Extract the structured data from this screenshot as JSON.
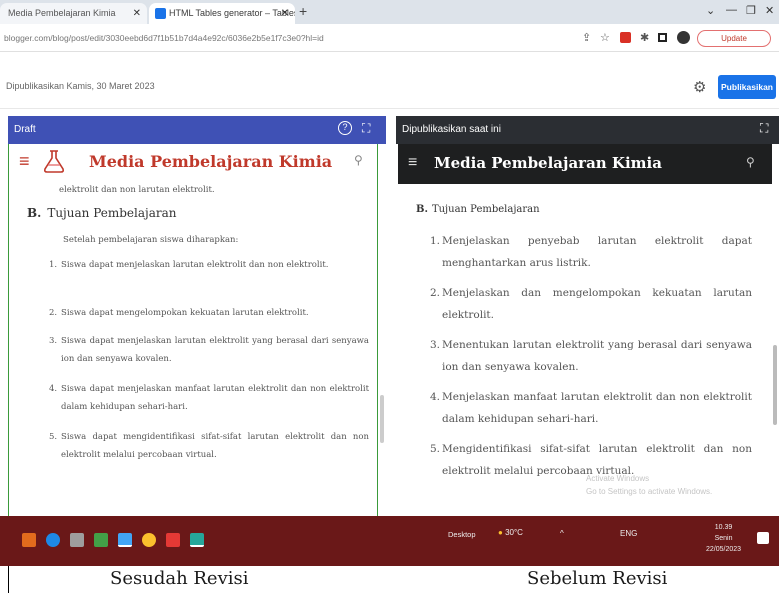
{
  "browser": {
    "tabs": [
      {
        "label": "Media Pembelajaran Kimia"
      },
      {
        "label": "HTML Tables generator – Tables"
      }
    ],
    "address": "blogger.com/blog/post/edit/3030eebd6d7f1b51b7d4a4e92c/6036e2b5e1f7c3e0?hl=id",
    "update_label": "Update"
  },
  "page": {
    "published_date": "Dipublikasikan Kamis, 30 Maret 2023",
    "publish_button": "Publikasikan"
  },
  "left": {
    "panel_label": "Draft",
    "site_title": "Media Pembelajaran Kimia",
    "cut_text": "elektrolit dan non larutan elektrolit.",
    "section_letter": "B.",
    "section_title": "Tujuan Pembelajaran",
    "intro": "Setelah pembelajaran siswa diharapkan:",
    "items": [
      {
        "n": "1.",
        "t": "Siswa dapat menjelaskan larutan elektrolit dan non elektrolit."
      },
      {
        "n": "2.",
        "t": "Siswa dapat mengelompokan kekuatan larutan elektrolit."
      },
      {
        "n": "3.",
        "t": "Siswa dapat menjelaskan larutan elektrolit yang berasal dari senyawa ion dan senyawa kovalen."
      },
      {
        "n": "4.",
        "t": "Siswa dapat menjelaskan manfaat larutan elektrolit dan non elektrolit dalam kehidupan sehari-hari."
      },
      {
        "n": "5.",
        "t": "Siswa dapat mengidentifikasi sifat-sifat larutan elektrolit dan non elektrolit melalui percobaan virtual."
      }
    ]
  },
  "right": {
    "panel_label": "Dipublikasikan saat ini",
    "site_title": "Media Pembelajaran Kimia",
    "section_letter": "B.",
    "section_title": "Tujuan Pembelajaran",
    "items": [
      {
        "n": "1.",
        "t": "Menjelaskan penyebab larutan elektrolit dapat menghantarkan arus listrik."
      },
      {
        "n": "2.",
        "t": "Menjelaskan dan mengelompokan kekuatan larutan elektrolit."
      },
      {
        "n": "3.",
        "t": "Menentukan larutan elektrolit yang berasal dari senyawa ion dan senyawa kovalen."
      },
      {
        "n": "4.",
        "t": "Menjelaskan manfaat larutan elektrolit dan non elektrolit dalam kehidupan sehari-hari."
      },
      {
        "n": "5.",
        "t": "Mengidentifikasi sifat-sifat larutan elektrolit dan non elektrolit melalui percobaan virtual."
      }
    ],
    "watermark_line1": "Activate Windows",
    "watermark_line2": "Go to Settings to activate Windows."
  },
  "taskbar": {
    "desktop_label": "Desktop",
    "temperature": "30°C",
    "lang": "ENG",
    "time": "10.39",
    "day": "Senin",
    "date": "22/05/2023"
  },
  "captions": {
    "left": "Sesudah Revisi",
    "right": "Sebelum Revisi"
  },
  "colors": {
    "draft_bar": "#3f51b5",
    "published_bar": "#2b2e33",
    "site_title_red": "#c0392b",
    "publish_button": "#1a73e8",
    "taskbar": "#6a1818"
  }
}
